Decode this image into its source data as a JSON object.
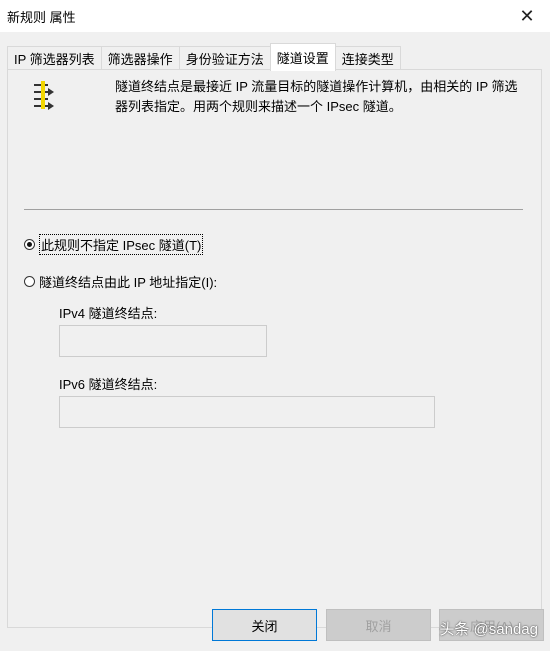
{
  "window": {
    "title": "新规则 属性",
    "close_glyph": "✕"
  },
  "tabs": [
    {
      "label": "IP 筛选器列表",
      "active": false
    },
    {
      "label": "筛选器操作",
      "active": false
    },
    {
      "label": "身份验证方法",
      "active": false
    },
    {
      "label": "隧道设置",
      "active": true
    },
    {
      "label": "连接类型",
      "active": false
    }
  ],
  "info": {
    "icon": "tunnel-endpoint-icon",
    "text": "隧道终结点是最接近 IP 流量目标的隧道操作计算机，由相关的 IP 筛选器列表指定。用两个规则来描述一个 IPsec 隧道。"
  },
  "options": {
    "no_tunnel": {
      "label": "此规则不指定 IPsec 隧道(T)",
      "checked": true
    },
    "by_ip": {
      "label": "隧道终结点由此 IP 地址指定(I):",
      "checked": false
    }
  },
  "fields": {
    "ipv4_label": "IPv4 隧道终结点:",
    "ipv4_value": "",
    "ipv6_label": "IPv6 隧道终结点:",
    "ipv6_value": ""
  },
  "buttons": {
    "close": "关闭",
    "cancel": "取消",
    "apply": "应用(A)"
  },
  "watermark": "头条 @sandag",
  "colors": {
    "dialog_bg": "#f0f0f0",
    "accent": "#0078d7",
    "icon_yellow": "#f2d600"
  }
}
